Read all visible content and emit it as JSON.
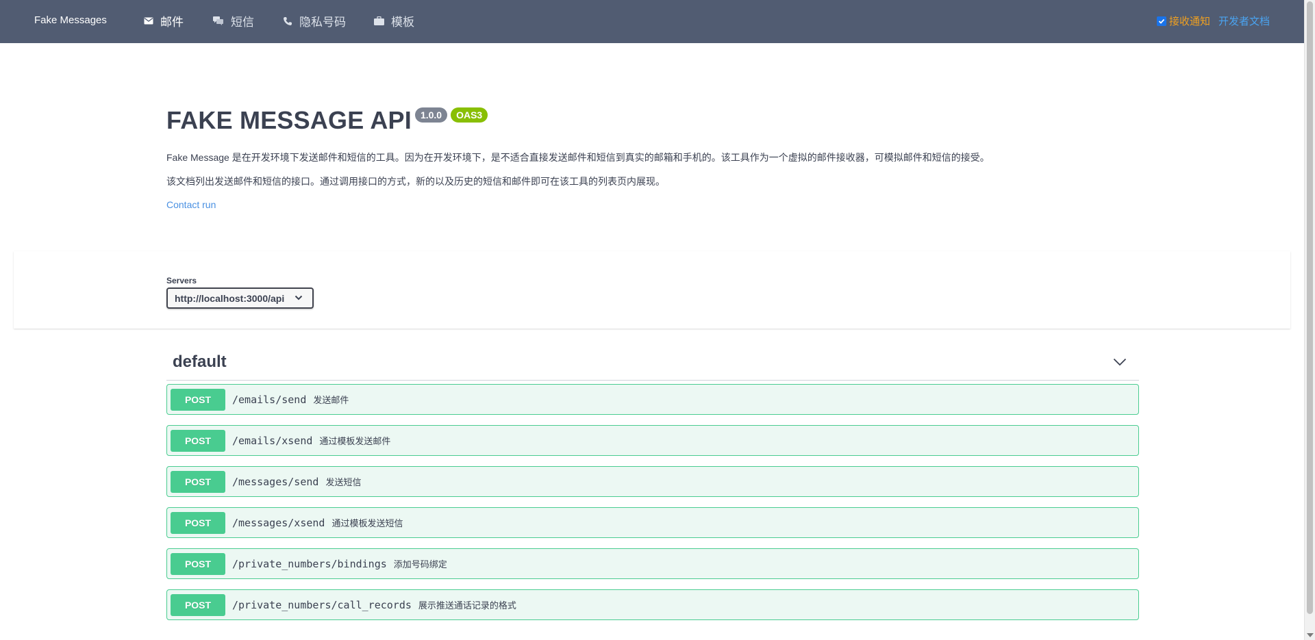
{
  "nav": {
    "brand": "Fake Messages",
    "items": [
      {
        "label": "邮件",
        "icon": "mail-icon",
        "active": true
      },
      {
        "label": "短信",
        "icon": "chat-icon",
        "active": false
      },
      {
        "label": "隐私号码",
        "icon": "phone-icon",
        "active": false
      },
      {
        "label": "模板",
        "icon": "briefcase-icon",
        "active": false
      }
    ],
    "notify_label": "接收通知",
    "notify_checked": true,
    "docs_label": "开发者文档"
  },
  "info": {
    "title": "FAKE MESSAGE API",
    "version": "1.0.0",
    "spec": "OAS3",
    "description_1": "Fake Message 是在开发环境下发送邮件和短信的工具。因为在开发环境下，是不适合直接发送邮件和短信到真实的邮箱和手机的。该工具作为一个虚拟的邮件接收器，可模拟邮件和短信的接受。",
    "description_2": "该文档列出发送邮件和短信的接口。通过调用接口的方式，新的以及历史的短信和邮件即可在该工具的列表页内展现。",
    "contact": "Contact run"
  },
  "servers": {
    "label": "Servers",
    "selected": "http://localhost:3000/api"
  },
  "tag": {
    "name": "default",
    "operations": [
      {
        "method": "POST",
        "path": "/emails/send",
        "summary": "发送邮件"
      },
      {
        "method": "POST",
        "path": "/emails/xsend",
        "summary": "通过模板发送邮件"
      },
      {
        "method": "POST",
        "path": "/messages/send",
        "summary": "发送短信"
      },
      {
        "method": "POST",
        "path": "/messages/xsend",
        "summary": "通过模板发送短信"
      },
      {
        "method": "POST",
        "path": "/private_numbers/bindings",
        "summary": "添加号码绑定"
      },
      {
        "method": "POST",
        "path": "/private_numbers/call_records",
        "summary": "展示推送通话记录的格式"
      }
    ]
  },
  "colors": {
    "topbar": "#515c72",
    "post": "#49cc90",
    "post_bg": "#ecf8f3",
    "link": "#4990e2",
    "notify": "#f0a020"
  }
}
